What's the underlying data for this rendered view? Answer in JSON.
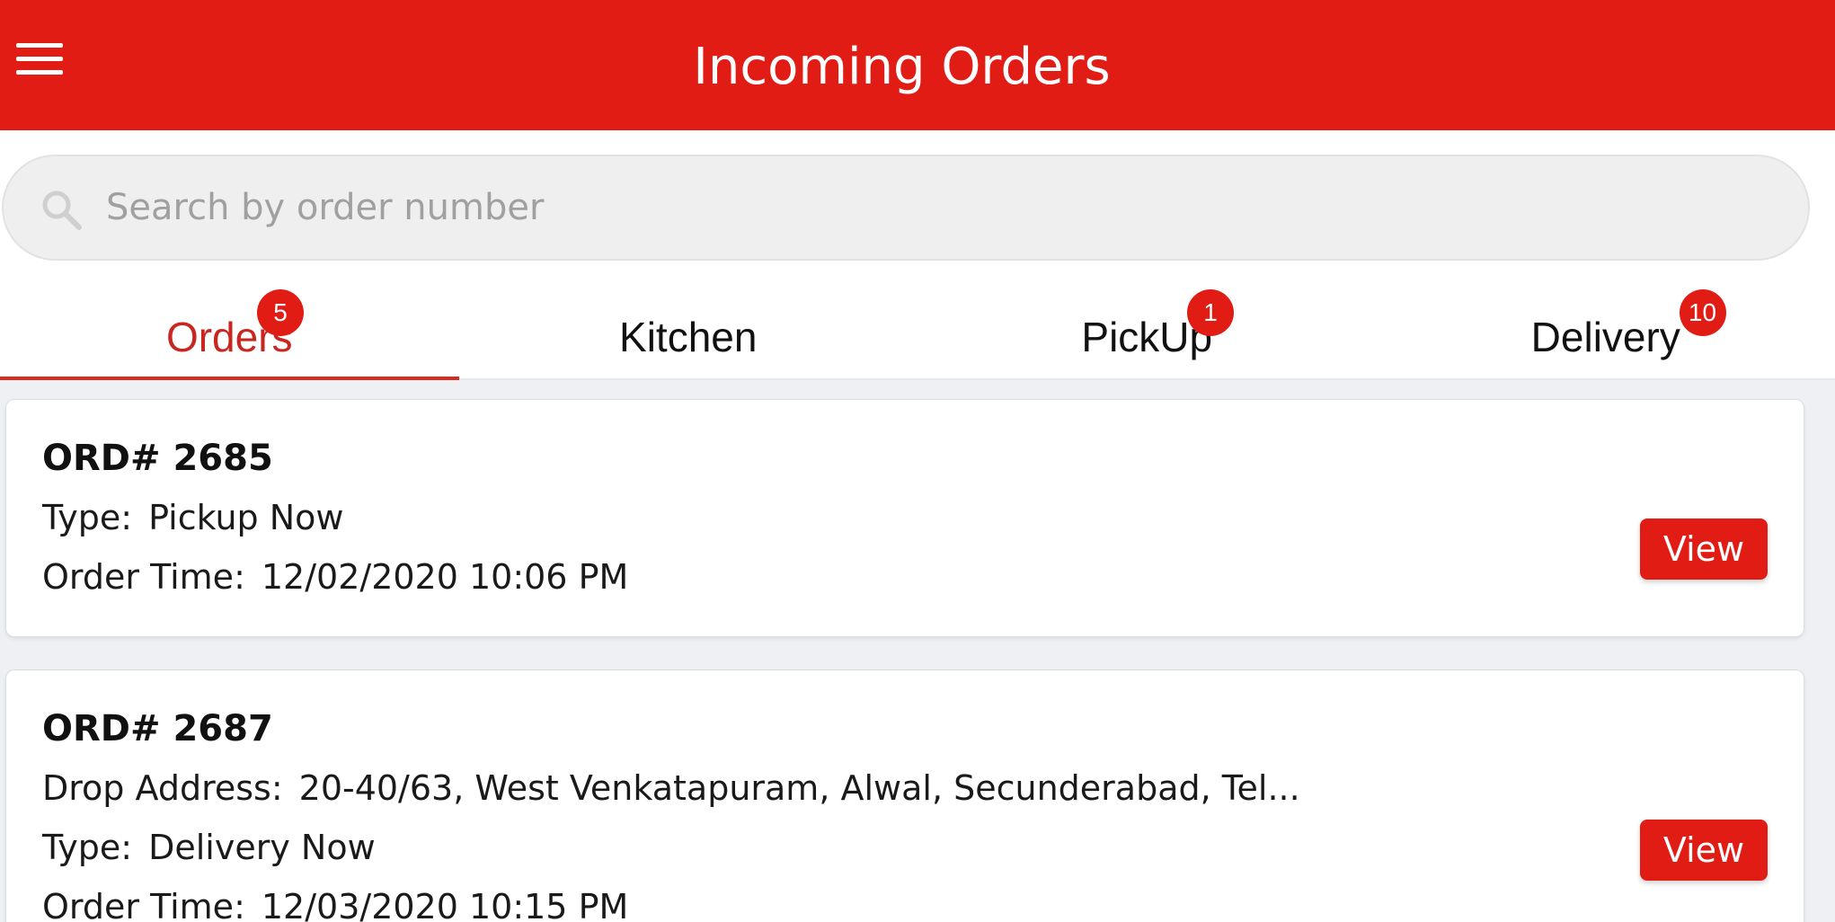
{
  "appbar": {
    "title": "Incoming Orders",
    "menu_icon": "hamburger-menu-icon",
    "color": "#e01c14"
  },
  "search": {
    "placeholder": "Search by order number",
    "value": "",
    "icon": "search-icon"
  },
  "tabs": [
    {
      "label": "Orders",
      "badge": "5",
      "active": true
    },
    {
      "label": "Kitchen",
      "badge": "",
      "active": false
    },
    {
      "label": "PickUp",
      "badge": "1",
      "active": false
    },
    {
      "label": "Delivery",
      "badge": "10",
      "active": false
    }
  ],
  "orders": [
    {
      "number": "ORD# 2685",
      "type_label": "Type:",
      "type_value": "Pickup Now",
      "time_label": "Order Time:",
      "time_value": "12/02/2020 10:06 PM",
      "view_label": "View"
    },
    {
      "number": "ORD# 2687",
      "address_label": "Drop Address:",
      "address_value": "20-40/63, West Venkatapuram, Alwal, Secunderabad, Tel...",
      "type_label": "Type:",
      "type_value": "Delivery Now",
      "time_label": "Order Time:",
      "time_value": "12/03/2020 10:15 PM",
      "view_label": "View"
    }
  ],
  "colors": {
    "accent": "#e01c14",
    "active_tab_text": "#c8261f",
    "background": "#eef0f3"
  }
}
